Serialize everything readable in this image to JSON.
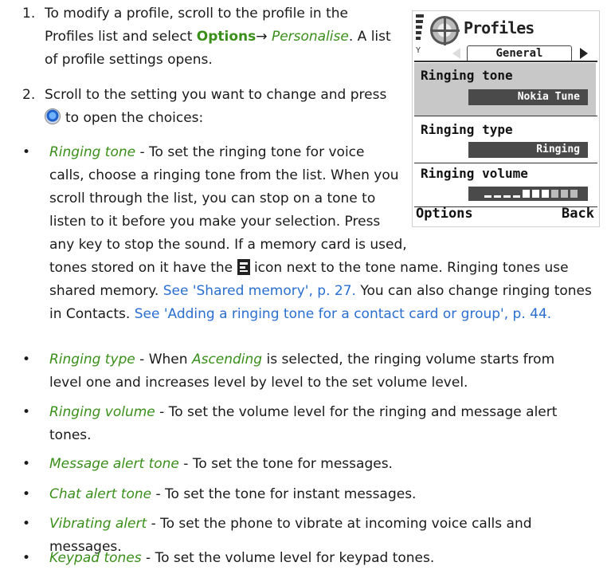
{
  "step1": {
    "number": "1.",
    "text_a": "To modify a profile, scroll to the profile in the",
    "text_b": "Profiles list and select",
    "options": "Options",
    "arrow": "→",
    "personalise": "Personalise",
    "text_c": ". A list",
    "text_d": "of profile settings opens."
  },
  "step2": {
    "number": "2.",
    "text_a": "Scroll to the setting you want to change and press",
    "text_b": "to open the choices:"
  },
  "bullets": {
    "ringing_tone": {
      "term": "Ringing tone",
      "l1": " - To set the ringing tone for voice",
      "l2": "calls, choose a ringing tone from the list. When you",
      "l3": "scroll through the list, you can stop on a tone to",
      "l4": "listen to it before you make your selection. Press",
      "l5": "any key to stop the sound. If a memory card is used,",
      "l6a": "tones stored on it have the",
      "l6b": "icon next to the tone name. Ringing tones use",
      "l7a": "shared memory.",
      "l7link": "See 'Shared memory', p. 27.",
      "l7b": " You can also change ringing tones",
      "l8a": "in Contacts.",
      "l8link": "See 'Adding a ringing tone for a contact card or group', p. 44."
    },
    "ringing_type": {
      "term": "Ringing type",
      "l1a": " - When",
      "ascending": "Ascending",
      "l1b": " is selected, the ringing volume starts from",
      "l2": "level one and increases level by level to the set volume level."
    },
    "ringing_volume": {
      "term": "Ringing volume",
      "l1": " - To set the volume level for the ringing and message alert",
      "l2": "tones."
    },
    "message_alert": {
      "term": "Message alert tone",
      "l1": " - To set the tone for messages."
    },
    "chat_alert": {
      "term": "Chat alert tone",
      "l1": " - To set the tone for instant messages."
    },
    "vibrating": {
      "term": "Vibrating alert",
      "l1": " - To set the phone to vibrate at incoming voice calls and",
      "l2": "messages."
    },
    "keypad": {
      "term": "Keypad tones",
      "l1": " - To set the volume level for keypad tones."
    }
  },
  "bullet_char": "•",
  "phone": {
    "title": "Profiles",
    "tab": "General",
    "rows": [
      {
        "label": "Ringing tone",
        "value": "Nokia Tune"
      },
      {
        "label": "Ringing type",
        "value": "Ringing"
      },
      {
        "label": "Ringing volume",
        "value": ""
      }
    ],
    "volume_level": 0.6,
    "left_soft": "Options",
    "right_soft": "Back",
    "highlight_color": "#c8c8c8"
  }
}
